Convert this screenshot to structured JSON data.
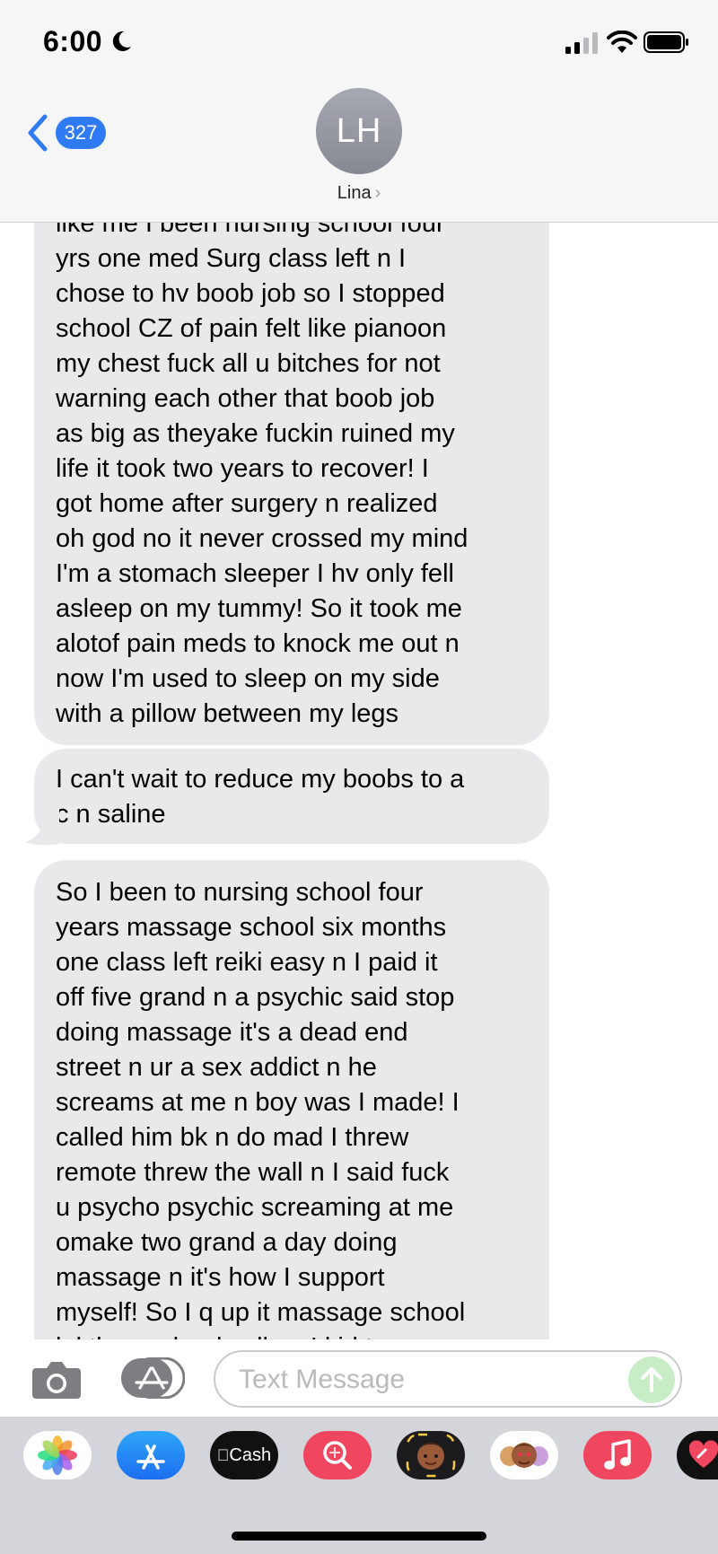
{
  "status_bar": {
    "time": "6:00"
  },
  "nav": {
    "back_count": "327",
    "avatar_initials": "LH",
    "contact_name": "Lina",
    "contact_chevron": "›"
  },
  "messages": [
    {
      "text": "like me I been nursing school four\nyrs one med Surg class left n I\nchose to hv boob job so I stopped\nschool CZ of pain felt like pianoon\nmy chest fuck all u bitches for not\nwarning each other that boob job\nas big as theyake fuckin ruined my\nlife it took two years to recover! I\ngot home after surgery n realized\noh god no it never crossed my mind\nI'm a stomach sleeper I hv only fell\nasleep on my tummy! So it took me\nalotof pain meds to knock me out n\nnow I'm used to sleep on my side\nwith a pillow between my legs"
    },
    {
      "text": "I can't wait to reduce my boobs to a\nc n saline"
    },
    {
      "text": "So I been to nursing school four\nyears massage school six months\none class left reiki easy n I paid it\noff five grand n a psychic said stop\ndoing massage it's a dead end\nstreet n ur a sex addict n he\nscreams at me n boy was I made! I\ncalled him bk n do mad I threw\nremote threw the wall n I said fuck\nu psycho psychic screaming at me\nomake two grand a day doing\nmassage n it's how I support\nmyself! So I q up it massage school\nlol then school calls n I kid to..."
    }
  ],
  "compose": {
    "placeholder": "Text Message"
  },
  "tray": {
    "apps": [
      {
        "name": "photos-app-icon"
      },
      {
        "name": "app-store-icon"
      },
      {
        "name": "apple-cash-icon",
        "label": "Cash"
      },
      {
        "name": "image-search-icon"
      },
      {
        "name": "memoji-icon"
      },
      {
        "name": "memoji-stickers-icon"
      },
      {
        "name": "music-icon"
      },
      {
        "name": "digital-touch-icon"
      }
    ]
  },
  "colors": {
    "accent": "#2f7bf5",
    "bubble_incoming": "#e9e9eb",
    "send_button_disabled": "#c8ecc6",
    "tray_background": "#d3d5da"
  }
}
